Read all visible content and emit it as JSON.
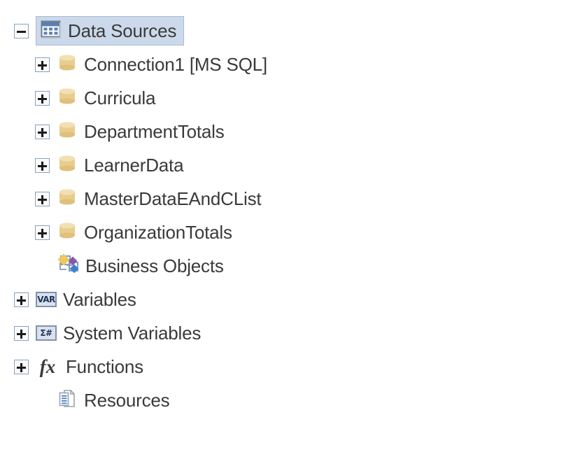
{
  "tree": {
    "root": {
      "label": "Data Sources",
      "icon": "table-grid-icon",
      "expander": "minus",
      "selected": true
    },
    "data_source_children": [
      {
        "label": "Connection1 [MS SQL]",
        "icon": "database-cylinder-icon",
        "expander": "plus"
      },
      {
        "label": "Curricula",
        "icon": "database-cylinder-icon",
        "expander": "plus"
      },
      {
        "label": "DepartmentTotals",
        "icon": "database-cylinder-icon",
        "expander": "plus"
      },
      {
        "label": "LearnerData",
        "icon": "database-cylinder-icon",
        "expander": "plus"
      },
      {
        "label": "MasterDataEAndCList",
        "icon": "database-cylinder-icon",
        "expander": "plus"
      },
      {
        "label": "OrganizationTotals",
        "icon": "database-cylinder-icon",
        "expander": "plus"
      }
    ],
    "business_objects": {
      "label": "Business Objects",
      "icon": "business-objects-diagram-icon",
      "expander": "none"
    },
    "top_level": [
      {
        "label": "Variables",
        "icon": "var-badge-icon",
        "badge_text": "VAR",
        "expander": "plus"
      },
      {
        "label": "System Variables",
        "icon": "sigma-hash-badge-icon",
        "badge_text": "Σ#",
        "expander": "plus"
      },
      {
        "label": "Functions",
        "icon": "fx-icon",
        "glyph": "fx",
        "expander": "plus"
      },
      {
        "label": "Resources",
        "icon": "documents-icon",
        "expander": "none"
      }
    ]
  },
  "colors": {
    "background": "#ffffff",
    "text": "#3a3a3a",
    "selection_fill": "#ccd9ea",
    "selection_border": "#a8bcd4",
    "cylinder": "#e8cd8e",
    "expander_border": "#8ba0bb"
  }
}
